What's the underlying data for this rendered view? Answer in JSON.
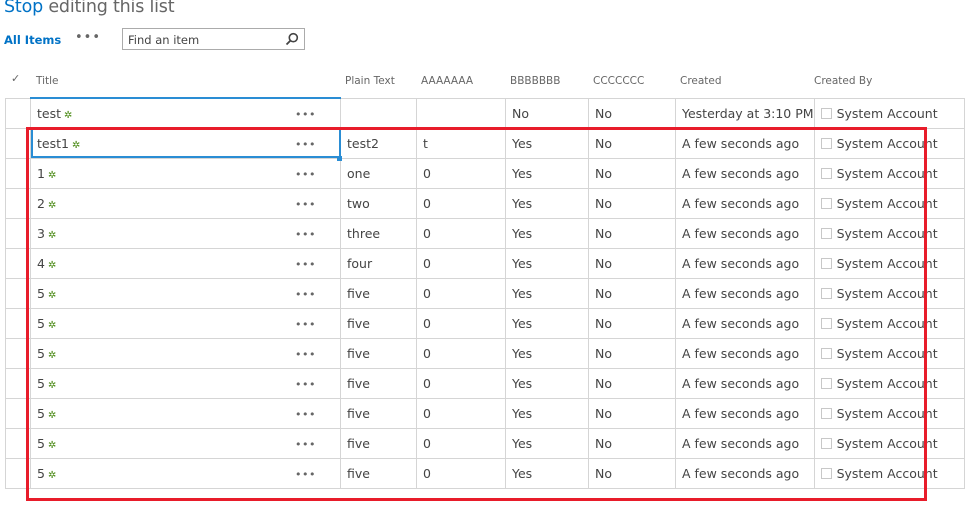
{
  "header": {
    "title_action": "Stop",
    "title_rest": " editing this list"
  },
  "toolbar": {
    "view_label": "All Items",
    "more_label": "•••",
    "search_placeholder": "Find an item",
    "search_icon": "magnifier-icon"
  },
  "columns": {
    "select": "✓",
    "title": "Title",
    "plain_text": "Plain Text",
    "aaaaaaa": "AAAAAAA",
    "bbbbbbb": "BBBBBBB",
    "ccccccc": "CCCCCCC",
    "created": "Created",
    "created_by": "Created By"
  },
  "row_menu_label": "•••",
  "new_icon_glyph": "✲",
  "rows": [
    {
      "title": "test",
      "plain_text": "",
      "aaaaaaa": "",
      "bbbbbbb": "No",
      "ccccccc": "No",
      "created": "Yesterday at 3:10 PM",
      "created_by": "System Account"
    },
    {
      "title": "test1",
      "plain_text": "test2",
      "aaaaaaa": "t",
      "bbbbbbb": "Yes",
      "ccccccc": "No",
      "created": "A few seconds ago",
      "created_by": "System Account"
    },
    {
      "title": "1",
      "plain_text": "one",
      "aaaaaaa": "0",
      "bbbbbbb": "Yes",
      "ccccccc": "No",
      "created": "A few seconds ago",
      "created_by": "System Account"
    },
    {
      "title": "2",
      "plain_text": "two",
      "aaaaaaa": "0",
      "bbbbbbb": "Yes",
      "ccccccc": "No",
      "created": "A few seconds ago",
      "created_by": "System Account"
    },
    {
      "title": "3",
      "plain_text": "three",
      "aaaaaaa": "0",
      "bbbbbbb": "Yes",
      "ccccccc": "No",
      "created": "A few seconds ago",
      "created_by": "System Account"
    },
    {
      "title": "4",
      "plain_text": "four",
      "aaaaaaa": "0",
      "bbbbbbb": "Yes",
      "ccccccc": "No",
      "created": "A few seconds ago",
      "created_by": "System Account"
    },
    {
      "title": "5",
      "plain_text": "five",
      "aaaaaaa": "0",
      "bbbbbbb": "Yes",
      "ccccccc": "No",
      "created": "A few seconds ago",
      "created_by": "System Account"
    },
    {
      "title": "5",
      "plain_text": "five",
      "aaaaaaa": "0",
      "bbbbbbb": "Yes",
      "ccccccc": "No",
      "created": "A few seconds ago",
      "created_by": "System Account"
    },
    {
      "title": "5",
      "plain_text": "five",
      "aaaaaaa": "0",
      "bbbbbbb": "Yes",
      "ccccccc": "No",
      "created": "A few seconds ago",
      "created_by": "System Account"
    },
    {
      "title": "5",
      "plain_text": "five",
      "aaaaaaa": "0",
      "bbbbbbb": "Yes",
      "ccccccc": "No",
      "created": "A few seconds ago",
      "created_by": "System Account"
    },
    {
      "title": "5",
      "plain_text": "five",
      "aaaaaaa": "0",
      "bbbbbbb": "Yes",
      "ccccccc": "No",
      "created": "A few seconds ago",
      "created_by": "System Account"
    },
    {
      "title": "5",
      "plain_text": "five",
      "aaaaaaa": "0",
      "bbbbbbb": "Yes",
      "ccccccc": "No",
      "created": "A few seconds ago",
      "created_by": "System Account"
    },
    {
      "title": "5",
      "plain_text": "five",
      "aaaaaaa": "0",
      "bbbbbbb": "Yes",
      "ccccccc": "No",
      "created": "A few seconds ago",
      "created_by": "System Account"
    }
  ],
  "annotation": {
    "highlight_color": "#e81c2a",
    "selection_color": "#2a8dd4"
  }
}
